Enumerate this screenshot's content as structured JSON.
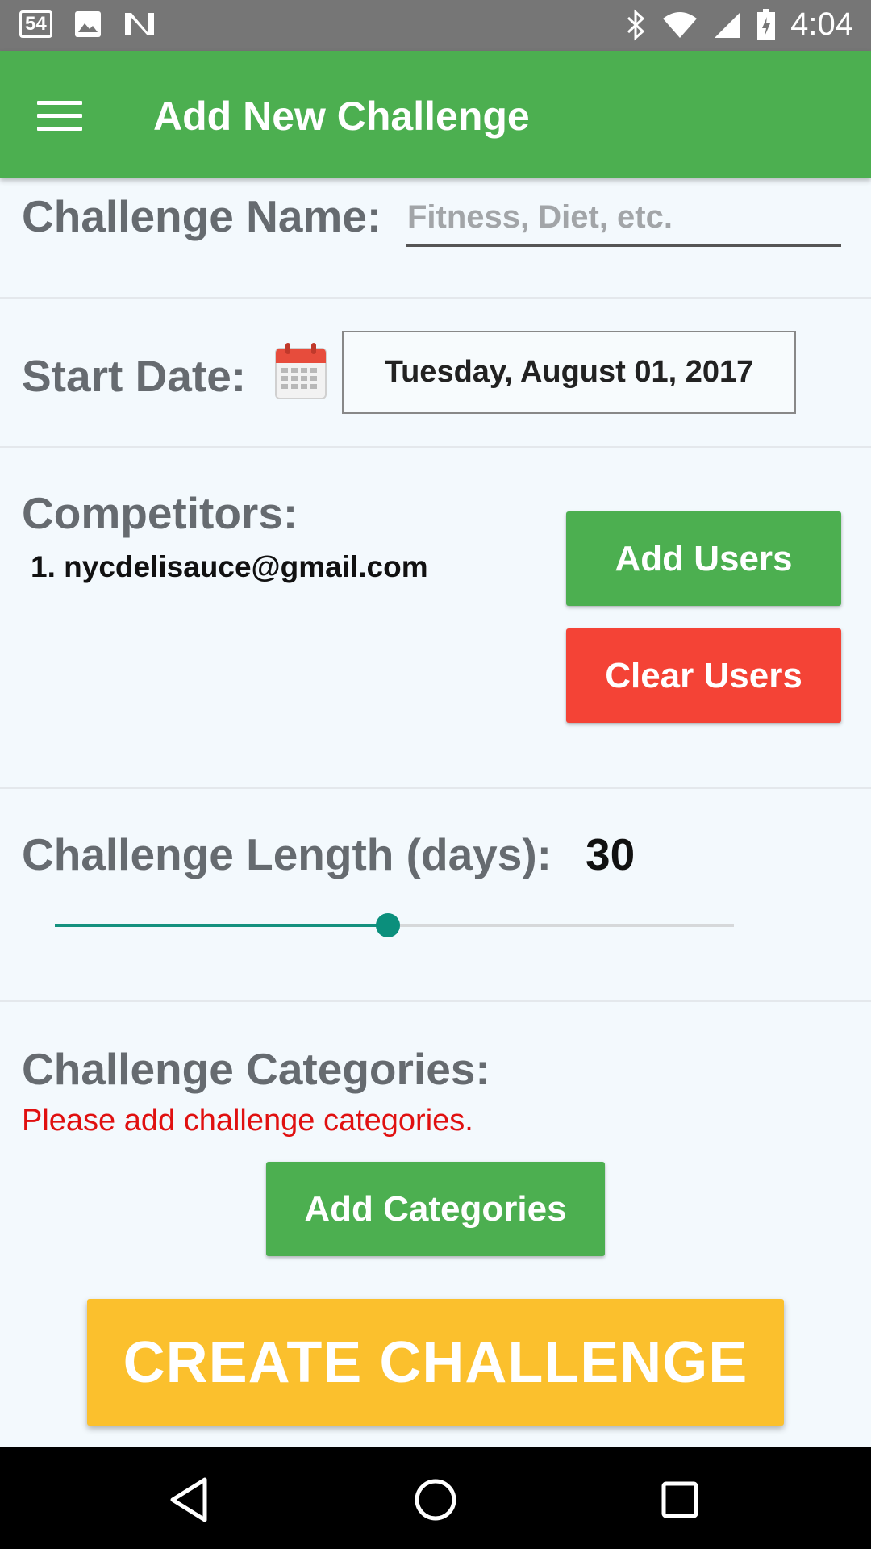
{
  "status_bar": {
    "notification_count": "54",
    "time": "4:04"
  },
  "app_bar": {
    "title": "Add New Challenge"
  },
  "challenge_name": {
    "label": "Challenge Name:",
    "placeholder": "Fitness, Diet, etc.",
    "value": ""
  },
  "start_date": {
    "label": "Start Date:",
    "value": "Tuesday, August 01, 2017"
  },
  "competitors": {
    "label": "Competitors:",
    "items": [
      "1. nycdelisauce@gmail.com"
    ],
    "add_button": "Add Users",
    "clear_button": "Clear Users"
  },
  "challenge_length": {
    "label": "Challenge Length (days):",
    "value": "30",
    "slider_fraction": 0.49
  },
  "categories": {
    "label": "Challenge Categories:",
    "warning": "Please add challenge categories.",
    "add_button": "Add Categories"
  },
  "create_button": "CREATE CHALLENGE",
  "colors": {
    "app_bar": "#4caf50",
    "add_button": "#4caf50",
    "clear_button": "#f44336",
    "create_button": "#fbc02d",
    "slider": "#0b8f7c",
    "warning_text": "#e01010"
  },
  "icons": {
    "status_left": [
      "notification-count-icon",
      "image-icon",
      "n-logo-icon"
    ],
    "status_right": [
      "bluetooth-icon",
      "wifi-icon",
      "cell-signal-icon",
      "battery-icon"
    ],
    "nav": [
      "back-icon",
      "home-icon",
      "recents-icon"
    ]
  }
}
